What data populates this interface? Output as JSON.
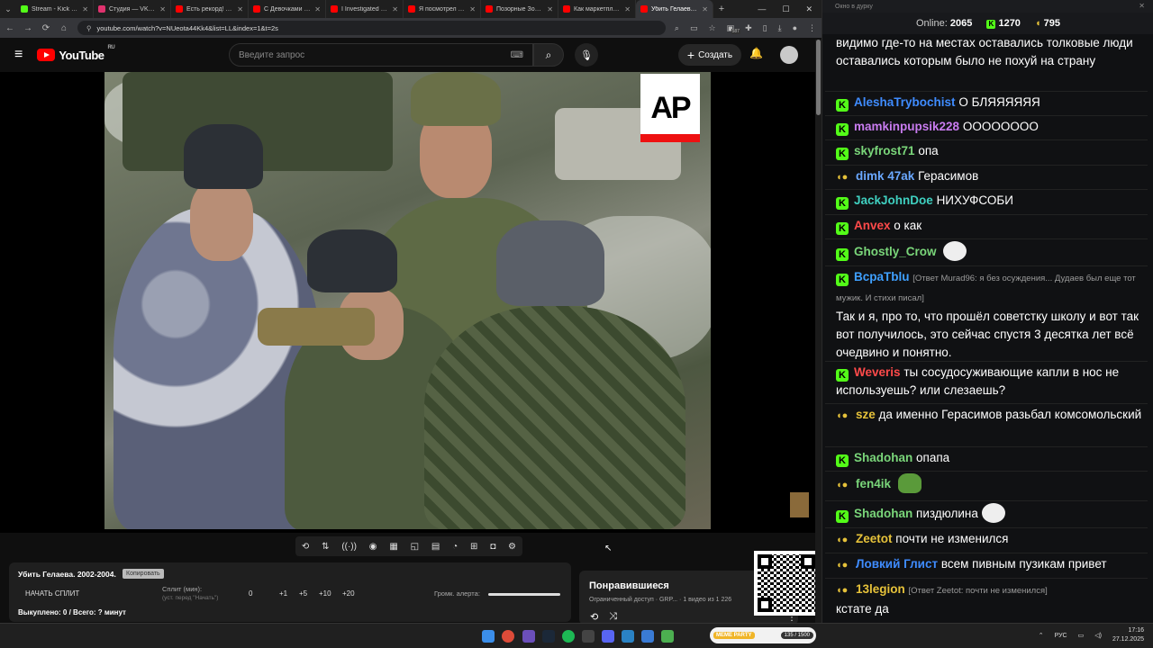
{
  "browser": {
    "tabs": [
      {
        "title": "Stream - Kick Dash",
        "color": "#53fc18",
        "active": false
      },
      {
        "title": "Студия — VK Видео",
        "color": "#e0326e",
        "active": false
      },
      {
        "title": "Есть рекорд! Пере...",
        "color": "#ff0000",
        "active": false
      },
      {
        "title": "С Девочками Бол...",
        "color": "#ff0000",
        "active": false
      },
      {
        "title": "I Investigated Mine...",
        "color": "#ff0000",
        "active": false
      },
      {
        "title": "Я посмотрел все г...",
        "color": "#ff0000",
        "active": false
      },
      {
        "title": "Позорные Зоозащ...",
        "color": "#ff0000",
        "active": false
      },
      {
        "title": "Как маркетплейсы...",
        "color": "#ff0000",
        "active": false
      },
      {
        "title": "Убить Гелаева...",
        "color": "#ff0000",
        "active": true
      }
    ],
    "url": "youtube.com/watch?v=NUeota44Kk4&list=LL&index=1&t=2s",
    "ext_badge": "587"
  },
  "youtube": {
    "logo_text": "YouTube",
    "region": "RU",
    "search_placeholder": "Введите запрос",
    "create_label": "Создать",
    "video_watermark": "AP"
  },
  "split": {
    "title": "Убить Гелаева. 2002-2004.",
    "copy_label": "Копировать",
    "start_label": "НАЧАТЬ СПЛИТ",
    "minutes_label": "Сплит (мин):",
    "minutes_hint": "(уст. перед \"Начать\")",
    "value": "0",
    "increments": [
      "+1",
      "+5",
      "+10",
      "+20"
    ],
    "volume_label": "Громк. алерта:",
    "status": "Выкуплено: 0 / Всего: ? минут"
  },
  "liked": {
    "title": "Понравившиеся",
    "subtitle": "Ограниченный доступ · GRP... · 1 видео из 1 226"
  },
  "chat": {
    "window_title": "Окно в дурку",
    "online_label": "Online:",
    "online_count": "2065",
    "kick_count": "1270",
    "other_count": "795",
    "messages": [
      {
        "badge": "",
        "user": "",
        "color": "#ffffff",
        "text": "видимо где-то на местах оставались толковые люди оставались которым было не похуй на страну",
        "reply": ""
      },
      {
        "badge": "k",
        "user": "AleshaTrybochist",
        "color": "#3f8cff",
        "text": "О БЛЯЯЯЯЯЯ",
        "reply": ""
      },
      {
        "badge": "k",
        "user": "mamkinpupsik228",
        "color": "#c97cf0",
        "text": "ОООООООО",
        "reply": ""
      },
      {
        "badge": "k",
        "user": "skyfrost71",
        "color": "#7ad67a",
        "text": "опа",
        "reply": ""
      },
      {
        "badge": "w",
        "user": "dimk 47ak",
        "color": "#6aa8ff",
        "text": "Герасимов",
        "reply": ""
      },
      {
        "badge": "k",
        "user": "JackJohnDoe",
        "color": "#3fd0c0",
        "text": "НИХУФСОБИ",
        "reply": ""
      },
      {
        "badge": "k",
        "user": "Anvex",
        "color": "#ff4a4a",
        "text": "о как",
        "reply": ""
      },
      {
        "badge": "k",
        "user": "Ghostly_Crow",
        "color": "#7ad67a",
        "text": "",
        "reply": ""
      },
      {
        "badge": "k",
        "user": "BcpaTblu",
        "color": "#3fa0ff",
        "text": "Так и я, про то, что прошёл советстку школу и вот так вот получилось, это сейчас спустя 3 десятка лет всё очедвино и понятно.",
        "reply": "[Ответ Murad96: я без осуждения... Дудаев был еще тот мужик. И стихи писал]"
      },
      {
        "badge": "k",
        "user": "Weveris",
        "color": "#ff4a4a",
        "text": "ты сосудосуживающие капли в нос не используешь? или слезаешь?",
        "reply": ""
      },
      {
        "badge": "w",
        "user": "sze",
        "color": "#e6c23a",
        "text": "да именно Герасимов разьбал комсомольский",
        "reply": ""
      },
      {
        "badge": "k",
        "user": "Shadohan",
        "color": "#7ad67a",
        "text": "опапа",
        "reply": ""
      },
      {
        "badge": "w",
        "user": "fen4ik",
        "color": "#7ad67a",
        "text": "",
        "reply": ""
      },
      {
        "badge": "k",
        "user": "Shadohan",
        "color": "#7ad67a",
        "text": "пиздюлина",
        "reply": ""
      },
      {
        "badge": "w",
        "user": "Zeetot",
        "color": "#e6c23a",
        "text": "почти не изменился",
        "reply": ""
      },
      {
        "badge": "w",
        "user": "Ловкий Глист",
        "color": "#3f8cff",
        "text": "всем пивным пузикам привет",
        "reply": ""
      },
      {
        "badge": "w",
        "user": "13legion",
        "color": "#e6c23a",
        "text": "кстате да",
        "reply": "[Ответ Zeetot: почти не изменился]"
      }
    ]
  },
  "taskbar": {
    "meme_label": "MEME PARTY",
    "meme_count": "135 / 1500",
    "lang": "РУС",
    "time": "17:16",
    "date": "27.12.2025"
  }
}
